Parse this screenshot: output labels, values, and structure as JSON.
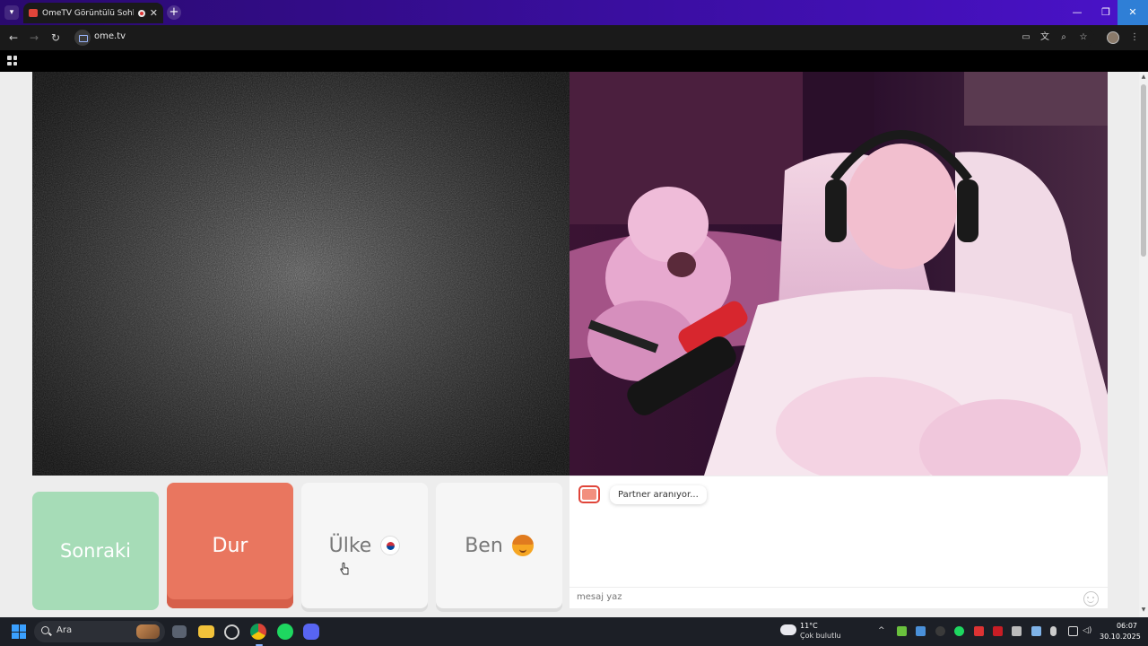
{
  "browser": {
    "tab_title": "OmeTV Görüntülü Sohbet",
    "tab_close": "✕",
    "new_tab": "+",
    "url": "ome.tv",
    "window_controls": {
      "minimize": "—",
      "restore": "❐",
      "close": "✕"
    }
  },
  "buttons": {
    "next": "Sonraki",
    "stop": "Dur",
    "country": "Ülke",
    "me": "Ben"
  },
  "chat": {
    "status_message": "Partner aranıyor...",
    "input_placeholder": "mesaj yaz"
  },
  "taskbar": {
    "search_label": "Ara",
    "weather_temp": "11°C",
    "weather_desc": "Çok bulutlu",
    "time": "06:07",
    "date": "30.10.2025"
  },
  "colors": {
    "next_button": "#a6dcb7",
    "stop_button": "#e9765f",
    "titlebar": "#3a0ea0"
  }
}
